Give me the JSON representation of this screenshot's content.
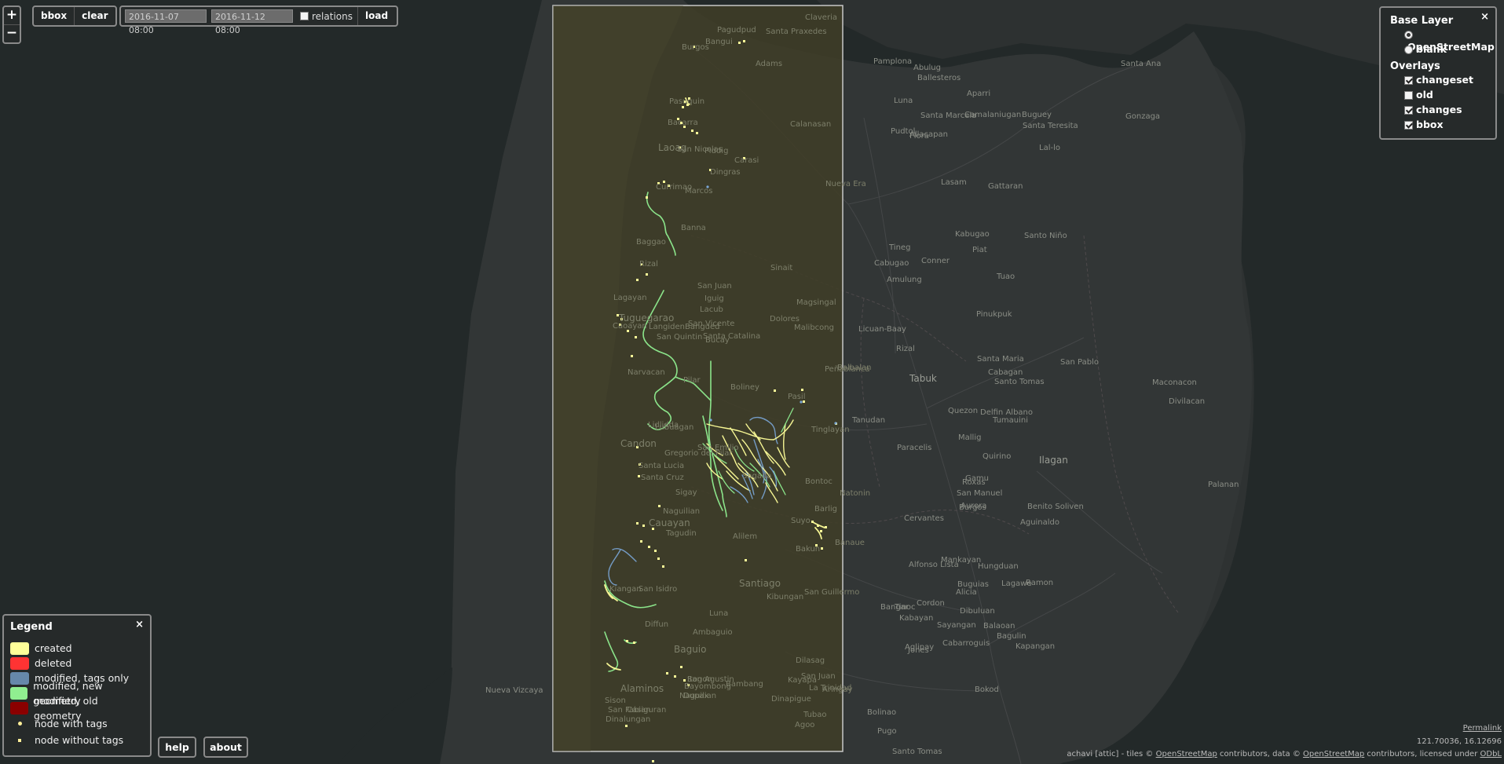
{
  "zoom": {
    "in_label": "+",
    "out_label": "−"
  },
  "toolbar": {
    "bbox_label": "bbox",
    "clear_label": "clear"
  },
  "timebar": {
    "from": "2016-11-07 08:00",
    "to": "2016-11-12 08:00",
    "relations_label": "relations",
    "relations_checked": false,
    "load_label": "load"
  },
  "layer_switcher": {
    "base_title": "Base Layer",
    "base_layers": [
      {
        "label": "OpenStreetMap",
        "selected": true
      },
      {
        "label": "blank",
        "selected": false
      }
    ],
    "overlays_title": "Overlays",
    "overlays": [
      {
        "label": "changeset",
        "checked": true
      },
      {
        "label": "old",
        "checked": false
      },
      {
        "label": "changes",
        "checked": true
      },
      {
        "label": "bbox",
        "checked": true
      }
    ],
    "close_label": "×"
  },
  "legend": {
    "title": "Legend",
    "close_label": "×",
    "items": [
      {
        "label": "created",
        "color": "#ffff99"
      },
      {
        "label": "deleted",
        "color": "#ff3333"
      },
      {
        "label": "modified, tags only",
        "color": "#6688aa"
      },
      {
        "label": "modified, new geometry",
        "color": "#90ee90"
      },
      {
        "label": "modified, old geometry",
        "color": "#8b0000"
      }
    ],
    "node_tags_label": "node with tags",
    "node_notags_label": "node without tags"
  },
  "buttons": {
    "help_label": "help",
    "about_label": "about"
  },
  "footer": {
    "permalink": "Permalink",
    "coords": "121.70036, 16.12696",
    "attrib_prefix": "achavi [attic]  -  tiles © ",
    "attrib_osm": "OpenStreetMap",
    "attrib_mid": " contributors, data © ",
    "attrib_osm2": "OpenStreetMap",
    "attrib_mid2": " contributors, licensed under ",
    "attrib_odbl": "ODbL"
  },
  "colors": {
    "map_bg": "#2b3030",
    "sea": "#232929",
    "bbox_fill": "#3f3d27",
    "bbox_border": "#c8c8c8",
    "created": "#ffff99",
    "modified_new": "#90ee90",
    "modified_tags": "#7aa6d6"
  },
  "places": [
    "Claveria",
    "Pagudpud",
    "Santa Praxedes",
    "Bangui",
    "Burgos",
    "Adams",
    "Pamplona",
    "Abulug",
    "Ballesteros",
    "Aparri",
    "Santa Ana",
    "Luna",
    "Santa Marcela",
    "Camalaniugan",
    "Buguey",
    "Gonzaga",
    "Pasuquin",
    "Bacarra",
    "Calanasan",
    "Pudtol",
    "Allacapan",
    "Flora",
    "Santa Teresita",
    "Lal-lo",
    "Laoag",
    "San Nicolas",
    "Piddig",
    "Carasi",
    "Dingras",
    "Lasam",
    "Gattaran",
    "Currimao",
    "Marcos",
    "Banna",
    "Nueva Era",
    "Kabugao",
    "Santo Niño",
    "Baggao",
    "Sinait",
    "Tineg",
    "Rizal",
    "Cabugao",
    "Conner",
    "Piat",
    "Amulung",
    "Tuao",
    "Iguig",
    "San Juan",
    "Lagayan",
    "Magsingal",
    "Lacub",
    "Dolores",
    "Licuan-Baay",
    "Pinukpuk",
    "Tuguegarao",
    "Santa Catalina",
    "San Vicente",
    "Bangued",
    "Langiden",
    "Malibcong",
    "Peñablanca",
    "Caoayan",
    "San Quintin",
    "Bucay",
    "Rizal",
    "Santa Maria",
    "San Pablo",
    "Narvacan",
    "Pilar",
    "Balbalan",
    "Tabuk",
    "Cabagan",
    "Santo Tomas",
    "Maconacon",
    "Boliney",
    "Pasil",
    "Lubuagan",
    "Tanudan",
    "Quezon",
    "Delfin Albano",
    "Tumauini",
    "Divilacan",
    "Lidlidda",
    "Tinglayan",
    "Candon",
    "San Emilio",
    "Gregorio del Pilar",
    "Paracelis",
    "Mallig",
    "Quirino",
    "Ilagan",
    "Santa Lucia",
    "Sagada",
    "Bontoc",
    "Natonin",
    "Roxas",
    "Burgos",
    "Santa Cruz",
    "Sigay",
    "Barlig",
    "Gamu",
    "Naguilian",
    "Palanan",
    "San Manuel",
    "Aurora",
    "Benito Soliven",
    "Suyo",
    "Cervantes",
    "Aguinaldo",
    "Cauayan",
    "Tagudin",
    "Alilem",
    "Bakun",
    "Banaue",
    "Alfonso Lista",
    "Mankayan",
    "Hungduan",
    "Lagawe",
    "Ramon",
    "Alicia",
    "San Isidro",
    "Santiago",
    "San Guillermo",
    "Bangar",
    "Buguias",
    "Kiangan",
    "Luna",
    "Kibungan",
    "Tinoc",
    "Cordon",
    "Dibuluan",
    "Balaoan",
    "Sayangan",
    "Kabayan",
    "Diffun",
    "Ambaguio",
    "Cabarroguis",
    "Bagulin",
    "Kapangan",
    "Aglipay",
    "Jones",
    "San Agustin",
    "San Juan",
    "La Trinidad",
    "Bokod",
    "Bayombong",
    "Naguilian",
    "Baguio",
    "Itogon",
    "Kayapa",
    "Bambang",
    "Dupax",
    "Dinapigue",
    "Dilasag",
    "Bolinao",
    "Aringay",
    "Tubao",
    "Agoo",
    "Pugo",
    "Santo Tomas",
    "Nueva Vizcaya",
    "Alaminos",
    "Sison",
    "San Fabian",
    "Casiguran",
    "Dinalungan"
  ]
}
